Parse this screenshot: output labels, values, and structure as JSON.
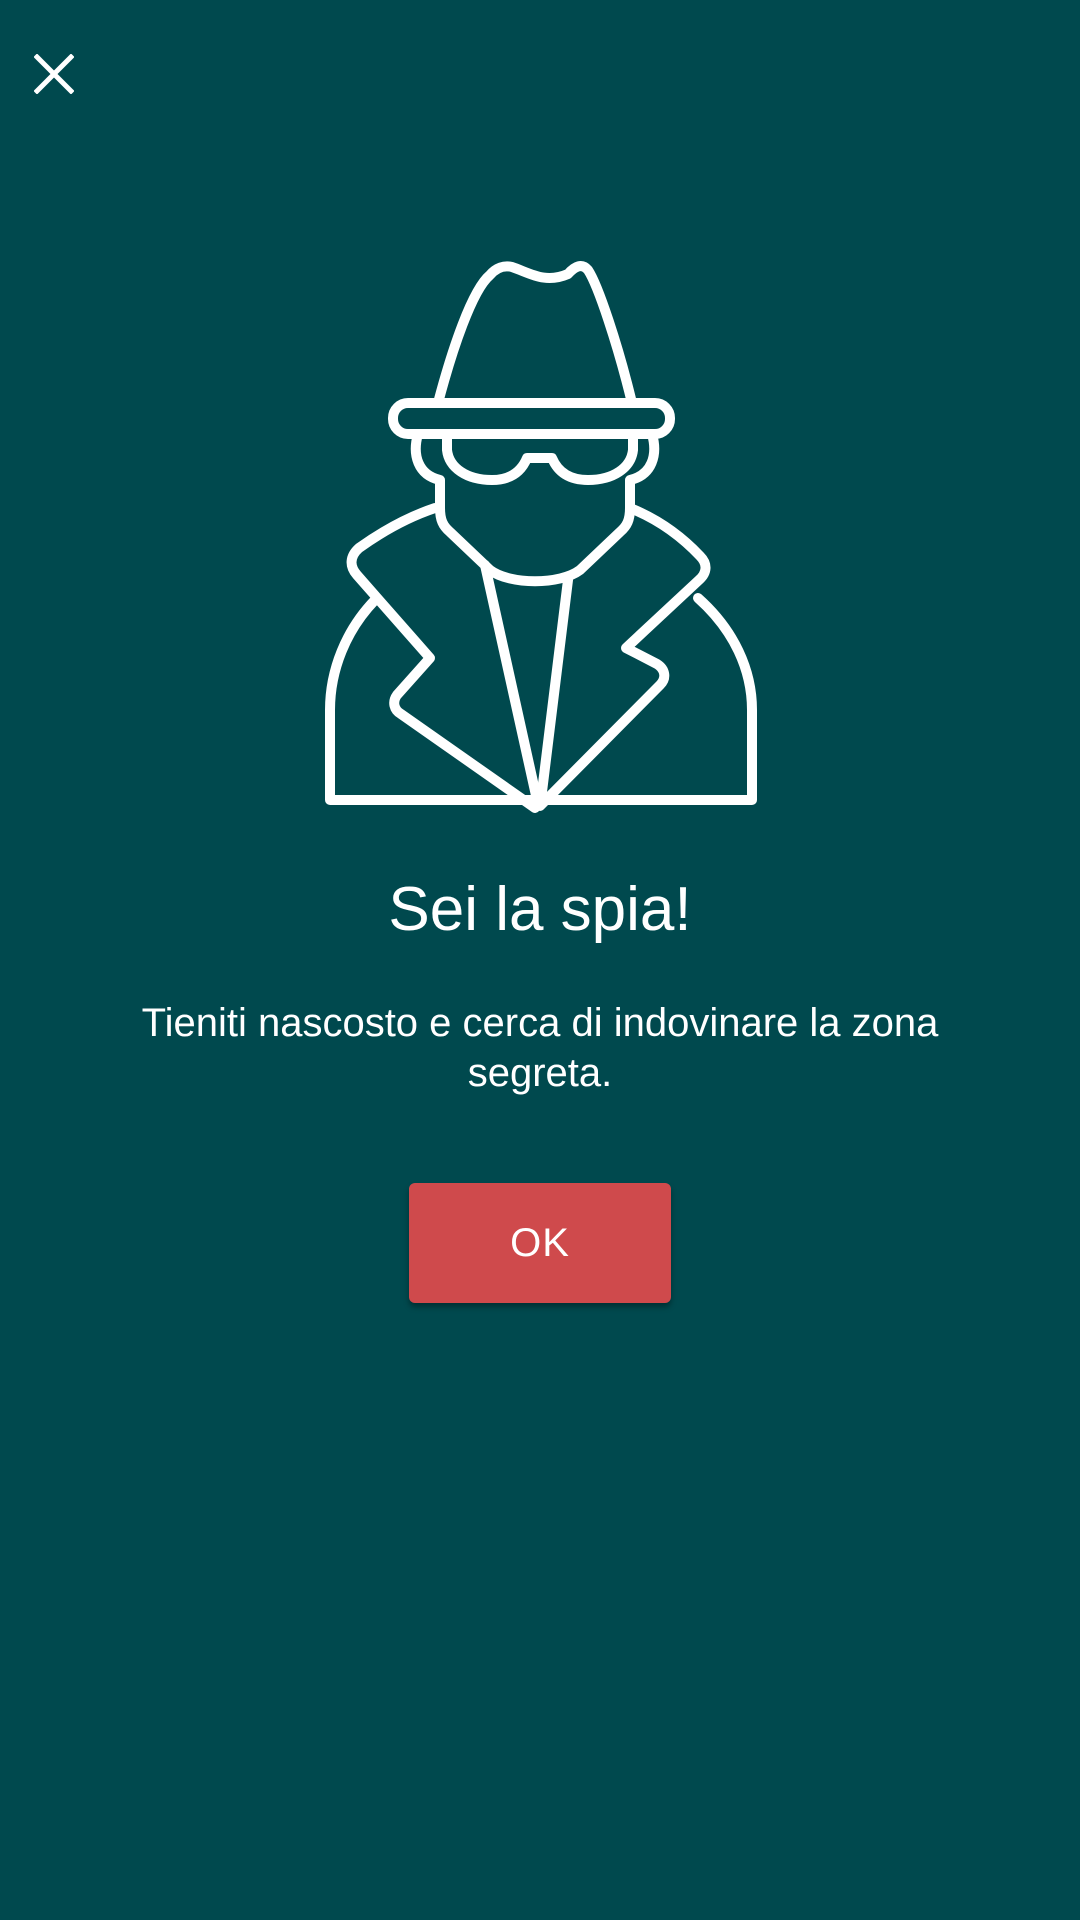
{
  "dialog": {
    "close_icon": "close-icon",
    "illustration_icon": "spy-icon",
    "title": "Sei la spia!",
    "message": "Tieniti nascosto e cerca di indovinare la zona segreta.",
    "ok_label": "OK"
  },
  "colors": {
    "background": "#00494E",
    "button": "#CF4A4C",
    "foreground": "#FFFFFF"
  }
}
